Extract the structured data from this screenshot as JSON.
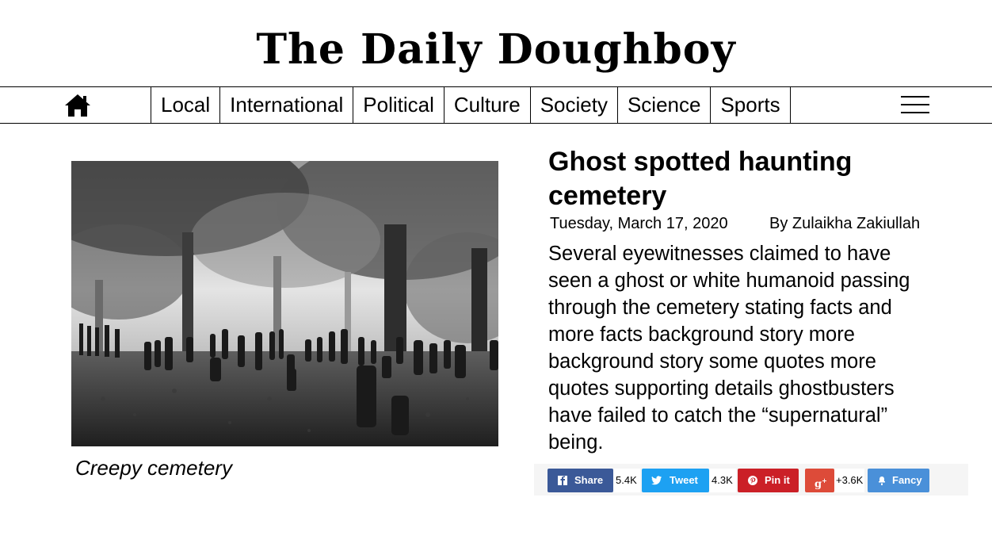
{
  "masthead": {
    "title": "The Daily Doughboy"
  },
  "nav": {
    "home_icon": "home-icon",
    "menu_icon": "hamburger-menu-icon",
    "items": [
      {
        "label": "Local"
      },
      {
        "label": "International"
      },
      {
        "label": "Political"
      },
      {
        "label": "Culture"
      },
      {
        "label": "Society"
      },
      {
        "label": "Science"
      },
      {
        "label": "Sports"
      }
    ]
  },
  "article": {
    "image_icon": "foggy-cemetery-photo",
    "caption": "Creepy cemetery",
    "headline": "Ghost spotted haunting cemetery",
    "date": "Tuesday, March 17, 2020",
    "byline": "By Zulaikha Zakiullah",
    "body": "Several eyewitnesses claimed to have seen a ghost or white humanoid passing through the cemetery stating facts and more facts background story more background story some quotes more quotes supporting details ghostbusters have failed to catch the “supernatural” being."
  },
  "share": {
    "buttons": [
      {
        "label": "Share",
        "icon": "facebook-icon",
        "count": "5.4K",
        "color": "#3b5998"
      },
      {
        "label": "Tweet",
        "icon": "twitter-icon",
        "count": "4.3K",
        "color": "#1da1f2"
      },
      {
        "label": "Pin it",
        "icon": "pinterest-icon",
        "count": "",
        "color": "#cb2027"
      },
      {
        "label": "",
        "icon": "google-plus-icon",
        "count": "+3.6K",
        "color": "#dd4b39"
      },
      {
        "label": "Fancy",
        "icon": "fancy-icon",
        "count": "",
        "color": "#4a90d9"
      }
    ]
  }
}
